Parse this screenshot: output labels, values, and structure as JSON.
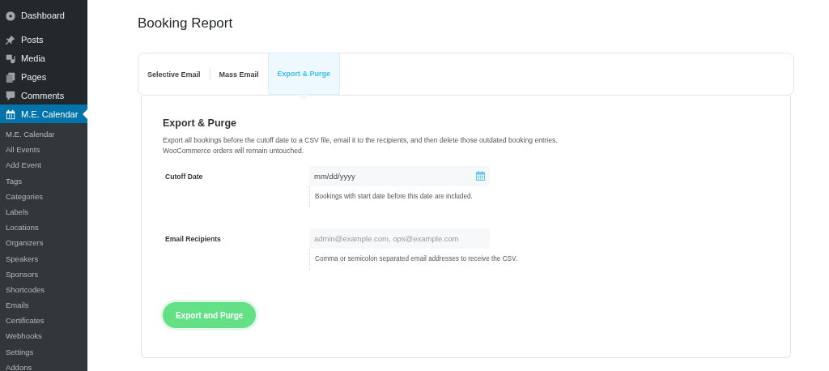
{
  "sidebar": {
    "items": [
      {
        "label": "Dashboard",
        "selected": false
      },
      {
        "label": "Posts",
        "selected": false
      },
      {
        "label": "Media",
        "selected": false
      },
      {
        "label": "Pages",
        "selected": false
      },
      {
        "label": "Comments",
        "selected": false
      },
      {
        "label": "M.E. Calendar",
        "selected": true
      }
    ],
    "submenu": [
      {
        "label": "M.E. Calendar",
        "selected": false
      },
      {
        "label": "All Events",
        "selected": false
      },
      {
        "label": "Add Event",
        "selected": false
      },
      {
        "label": "Tags",
        "selected": false
      },
      {
        "label": "Categories",
        "selected": false
      },
      {
        "label": "Labels",
        "selected": false
      },
      {
        "label": "Locations",
        "selected": false
      },
      {
        "label": "Organizers",
        "selected": false
      },
      {
        "label": "Speakers",
        "selected": false
      },
      {
        "label": "Sponsors",
        "selected": false
      },
      {
        "label": "Shortcodes",
        "selected": false
      },
      {
        "label": "Emails",
        "selected": false
      },
      {
        "label": "Certificates",
        "selected": false
      },
      {
        "label": "Webhooks",
        "selected": false
      },
      {
        "label": "Settings",
        "selected": false
      },
      {
        "label": "Addons",
        "selected": false
      }
    ]
  },
  "page": {
    "title": "Booking Report"
  },
  "tabs": [
    {
      "label": "Selective Email",
      "selected": false
    },
    {
      "label": "Mass Email",
      "selected": false
    },
    {
      "label": "Export & Purge",
      "selected": true
    }
  ],
  "panel": {
    "heading": "Export & Purge",
    "description": [
      "Export all bookings before the cutoff date to a CSV file, email it to the recipients, and then delete those outdated booking entries.",
      "WooCommerce orders will remain untouched."
    ],
    "fields": [
      {
        "kind": "date",
        "label": "Cutoff Date",
        "placeholder": "mm/dd/yyyy",
        "hint": "Bookings with start date before this date are included."
      },
      {
        "kind": "text",
        "label": "Email Recipients",
        "placeholder": "admin@example.com, ops@example.com",
        "hint": "Comma or semicolon separated email addresses to receive the CSV."
      }
    ],
    "button": "Export and Purge"
  }
}
